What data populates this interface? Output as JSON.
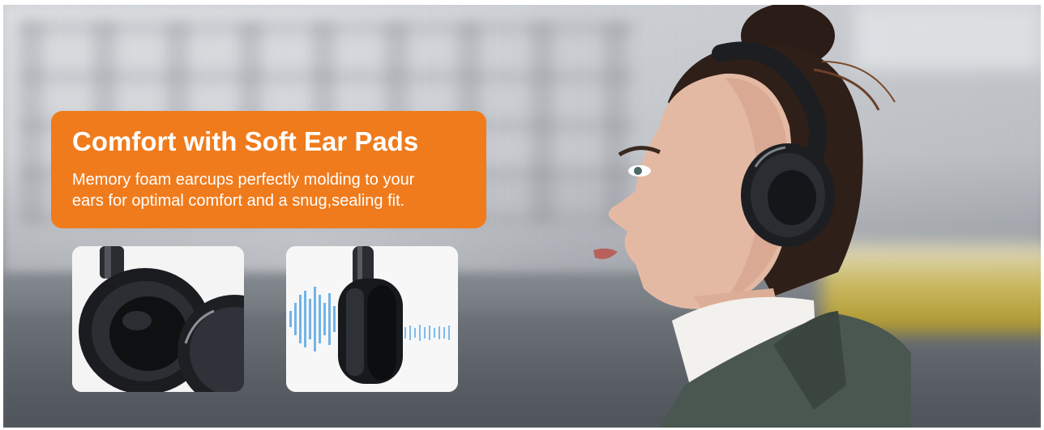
{
  "banner": {
    "title": "Comfort with Soft Ear Pads",
    "description_line1": "Memory foam earcups perfectly molding to your",
    "description_line2": "ears for optimal comfort and a snug,sealing fit.",
    "colors": {
      "accent": "#f07b1c",
      "text": "#ffffff",
      "card_background": "#f7f7f7",
      "headphone": "#1c1e21",
      "sound_wave": "#5aa9e6"
    }
  },
  "cards": [
    {
      "name": "earcup-closeup-image"
    },
    {
      "name": "sound-isolation-image"
    }
  ],
  "icons": [
    "headphone-earcup-icon",
    "sound-wave-icon"
  ]
}
